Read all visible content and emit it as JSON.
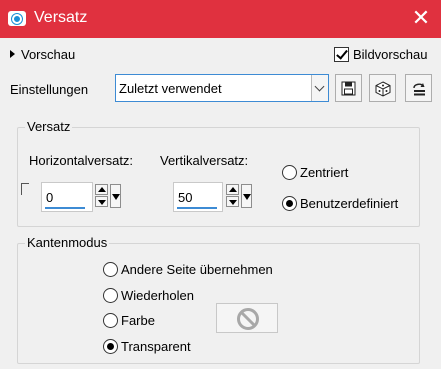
{
  "window": {
    "title": "Versatz",
    "title_icon": "camera-icon",
    "close_icon": "close-icon"
  },
  "preview": {
    "toggle_label": "Vorschau",
    "bild_label": "Bildvorschau",
    "bild_checked": true
  },
  "settings": {
    "label": "Einstellungen",
    "selected": "Zuletzt verwendet",
    "buttons": [
      {
        "name": "save-preset-icon"
      },
      {
        "name": "random-dice-icon"
      },
      {
        "name": "reset-icon"
      }
    ]
  },
  "offset_group": {
    "title": "Versatz",
    "horizontal_label": "Horizontalversatz:",
    "horizontal_value": "0",
    "vertical_label": "Vertikalversatz:",
    "vertical_value": "50",
    "options": [
      {
        "label": "Zentriert",
        "selected": false
      },
      {
        "label": "Benutzerdefiniert",
        "selected": true
      }
    ]
  },
  "edge_group": {
    "title": "Kantenmodus",
    "options": [
      {
        "label": "Andere Seite übernehmen",
        "selected": false
      },
      {
        "label": "Wiederholen",
        "selected": false
      },
      {
        "label": "Farbe",
        "selected": false
      },
      {
        "label": "Transparent",
        "selected": true
      }
    ],
    "color_icon": "no-color-icon"
  },
  "colors": {
    "titlebar": "#e0313f",
    "accent": "#3d8bd4",
    "background": "#f0f0f0"
  }
}
